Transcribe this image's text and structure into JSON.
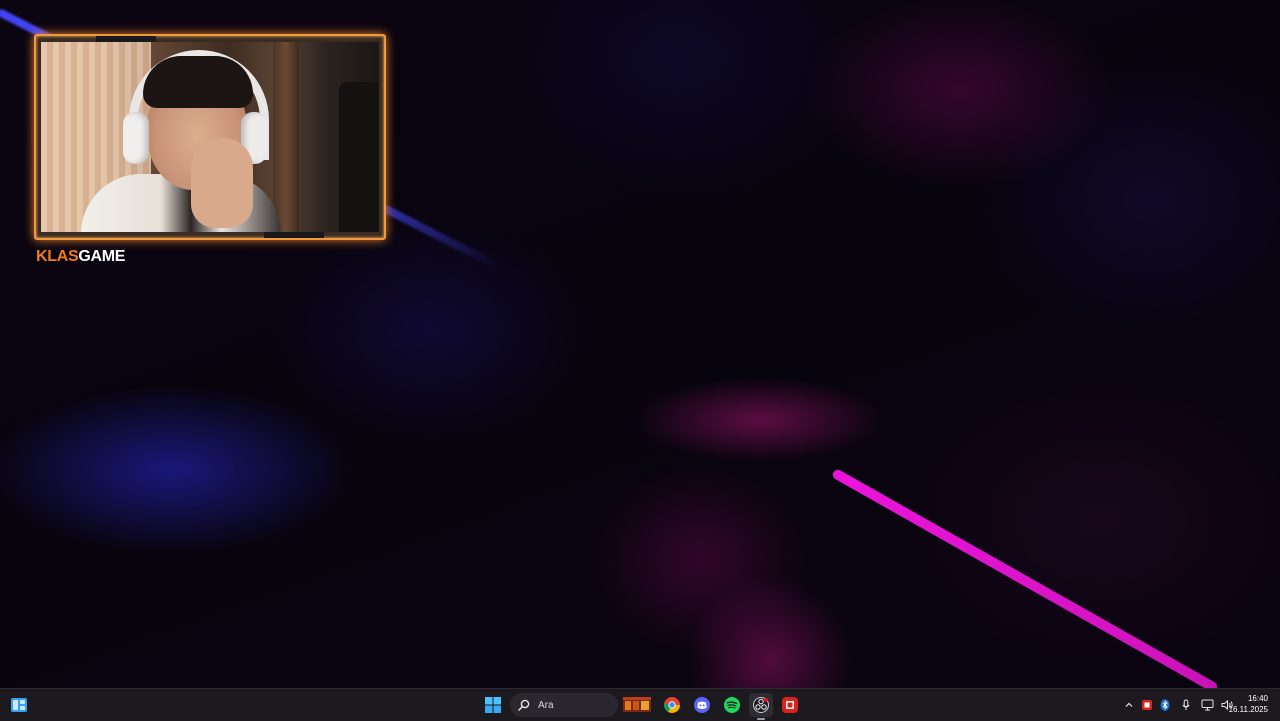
{
  "webcam": {
    "brand_part1": "KLAS",
    "brand_part2": "GAME",
    "frame_color": "#f29a3b",
    "brand_color": "#f07a1c"
  },
  "wallpaper": {
    "streak_colors": [
      "#4646ff",
      "#eb14dc"
    ]
  },
  "taskbar": {
    "search_placeholder": "Ara",
    "pinned_apps": [
      {
        "name": "game-app",
        "icon": "game-tile-icon"
      },
      {
        "name": "chrome",
        "icon": "chrome-icon"
      },
      {
        "name": "discord",
        "icon": "discord-icon"
      },
      {
        "name": "spotify",
        "icon": "spotify-icon"
      },
      {
        "name": "obs",
        "icon": "obs-icon"
      },
      {
        "name": "red-app",
        "icon": "red-app-icon"
      }
    ],
    "tray_icons": [
      "chevron-up-icon",
      "red-app-tray-icon",
      "bluetooth-icon",
      "microphone-icon",
      "network-icon",
      "volume-icon"
    ],
    "time": "16:40",
    "date": "16.11.2025"
  }
}
